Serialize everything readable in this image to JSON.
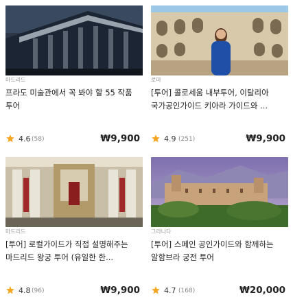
{
  "cards": [
    {
      "city": "마드리드",
      "title": "프라도 미술관에서 꼭 봐야 할 55 작품 투어",
      "rating": "4.6",
      "count": "(58)",
      "price": "₩9,900",
      "image": "madrid-building-photo"
    },
    {
      "city": "로마",
      "title": "[투어] 콜로세움 내부투어, 이탈리아 국가공인가이드 키아라 가이드와 ...",
      "rating": "4.9",
      "count": "(251)",
      "price": "₩9,900",
      "image": "colosseum-photo"
    },
    {
      "city": "마드리드",
      "title": "[투어] 로컬가이드가 직접 설명해주는 마드리드 왕궁 투어 (유일한 한...",
      "rating": "4.8",
      "count": "(96)",
      "price": "₩9,900",
      "image": "royal-palace-interior-photo"
    },
    {
      "city": "그라나다",
      "title": "[투어] 스페인 공인가이드와 함께하는 알함브라 궁전 투어",
      "rating": "4.7",
      "count": "(168)",
      "price": "₩20,000",
      "image": "alhambra-photo"
    }
  ],
  "colors": {
    "star": "#f5a623",
    "text": "#222222",
    "muted": "#999999"
  },
  "icons": {
    "star": "star-icon"
  }
}
